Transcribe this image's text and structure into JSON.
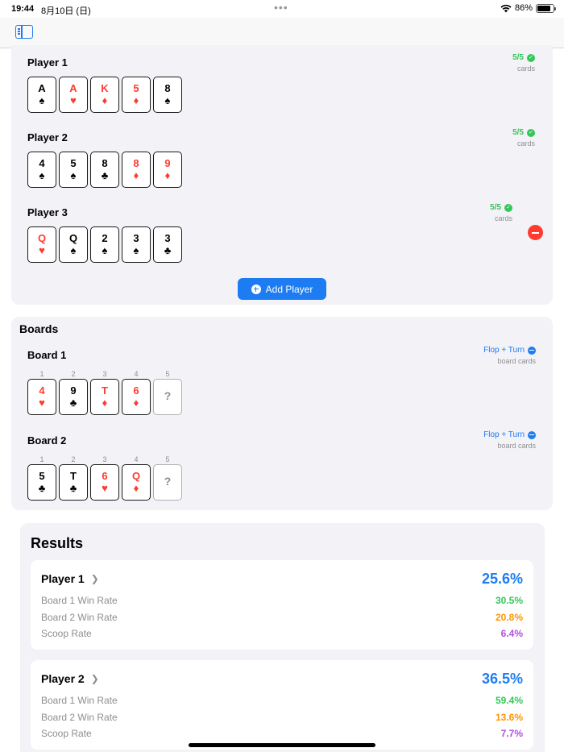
{
  "status": {
    "time": "19:44",
    "date": "8月10日 (日)",
    "battery": "86%",
    "battery_level": 0.86
  },
  "players": {
    "items": [
      {
        "name": "Player 1",
        "count": "5/5",
        "count_sub": "cards",
        "cards": [
          {
            "rank": "A",
            "suit": "♠",
            "color": "black"
          },
          {
            "rank": "A",
            "suit": "♥",
            "color": "red"
          },
          {
            "rank": "K",
            "suit": "♦",
            "color": "red"
          },
          {
            "rank": "5",
            "suit": "♦",
            "color": "red"
          },
          {
            "rank": "8",
            "suit": "♠",
            "color": "black"
          }
        ]
      },
      {
        "name": "Player 2",
        "count": "5/5",
        "count_sub": "cards",
        "cards": [
          {
            "rank": "4",
            "suit": "♠",
            "color": "black"
          },
          {
            "rank": "5",
            "suit": "♠",
            "color": "black"
          },
          {
            "rank": "8",
            "suit": "♣",
            "color": "black"
          },
          {
            "rank": "8",
            "suit": "♦",
            "color": "red"
          },
          {
            "rank": "9",
            "suit": "♦",
            "color": "red"
          }
        ]
      },
      {
        "name": "Player 3",
        "count": "5/5",
        "count_sub": "cards",
        "cards": [
          {
            "rank": "Q",
            "suit": "♥",
            "color": "red"
          },
          {
            "rank": "Q",
            "suit": "♠",
            "color": "black"
          },
          {
            "rank": "2",
            "suit": "♠",
            "color": "black"
          },
          {
            "rank": "3",
            "suit": "♠",
            "color": "black"
          },
          {
            "rank": "3",
            "suit": "♣",
            "color": "black"
          }
        ]
      }
    ],
    "add_label": "Add Player"
  },
  "boards": {
    "title": "Boards",
    "items": [
      {
        "name": "Board 1",
        "mode": "Flop + Turn",
        "mode_sub": "board cards",
        "slots": [
          "1",
          "2",
          "3",
          "4",
          "5"
        ],
        "cards": [
          {
            "rank": "4",
            "suit": "♥",
            "color": "red"
          },
          {
            "rank": "9",
            "suit": "♣",
            "color": "black"
          },
          {
            "rank": "T",
            "suit": "♦",
            "color": "red"
          },
          {
            "rank": "6",
            "suit": "♦",
            "color": "red"
          },
          {
            "rank": "?",
            "suit": "",
            "color": "empty"
          }
        ]
      },
      {
        "name": "Board 2",
        "mode": "Flop + Turn",
        "mode_sub": "board cards",
        "slots": [
          "1",
          "2",
          "3",
          "4",
          "5"
        ],
        "cards": [
          {
            "rank": "5",
            "suit": "♣",
            "color": "black"
          },
          {
            "rank": "T",
            "suit": "♣",
            "color": "black"
          },
          {
            "rank": "6",
            "suit": "♥",
            "color": "red"
          },
          {
            "rank": "Q",
            "suit": "♦",
            "color": "red"
          },
          {
            "rank": "?",
            "suit": "",
            "color": "empty"
          }
        ]
      }
    ]
  },
  "results": {
    "title": "Results",
    "items": [
      {
        "name": "Player 1",
        "total": "25.6%",
        "board1_label": "Board 1 Win Rate",
        "board1": "30.5%",
        "board2_label": "Board 2 Win Rate",
        "board2": "20.8%",
        "scoop_label": "Scoop Rate",
        "scoop": "6.4%"
      },
      {
        "name": "Player 2",
        "total": "36.5%",
        "board1_label": "Board 1 Win Rate",
        "board1": "59.4%",
        "board2_label": "Board 2 Win Rate",
        "board2": "13.6%",
        "scoop_label": "Scoop Rate",
        "scoop": "7.7%"
      }
    ]
  }
}
